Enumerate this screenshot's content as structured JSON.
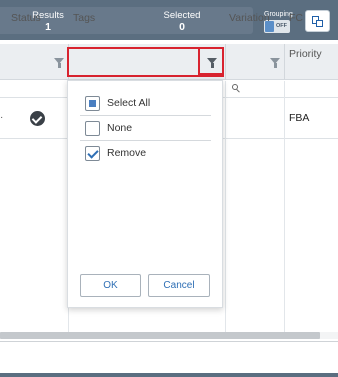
{
  "summary": {
    "results_label": "Results",
    "results_value": "1",
    "selected_label": "Selected",
    "selected_value": "0"
  },
  "grouping": {
    "label": "Grouping",
    "state": "OFF"
  },
  "columns": {
    "status": "Status",
    "tags": "Tags",
    "variation": "Variation",
    "fc_priority": "FC Priority"
  },
  "row": {
    "status_icon": "check-circle-icon",
    "fc_priority": "FBA"
  },
  "tags_filter": {
    "options": [
      {
        "label": "Select All",
        "state": "partial"
      },
      {
        "label": "None",
        "state": "unchecked"
      },
      {
        "label": "Remove",
        "state": "checked"
      }
    ],
    "ok_label": "OK",
    "cancel_label": "Cancel"
  },
  "colors": {
    "header_bar": "#5b6e80",
    "highlight": "#d8232f",
    "accent": "#2f6fb5"
  }
}
